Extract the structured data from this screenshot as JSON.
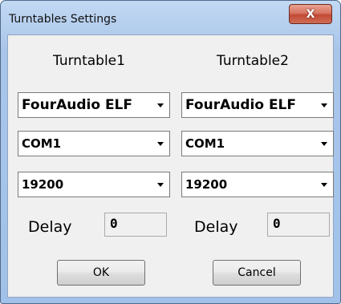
{
  "window": {
    "title": "Turntables Settings",
    "close_label": "X"
  },
  "turntable1": {
    "header": "Turntable1",
    "model": "FourAudio ELF",
    "port": "COM1",
    "baud": "19200",
    "delay_label": "Delay",
    "delay_value": "0"
  },
  "turntable2": {
    "header": "Turntable2",
    "model": "FourAudio ELF",
    "port": "COM1",
    "baud": "19200",
    "delay_label": "Delay",
    "delay_value": "0"
  },
  "buttons": {
    "ok": "OK",
    "cancel": "Cancel"
  }
}
